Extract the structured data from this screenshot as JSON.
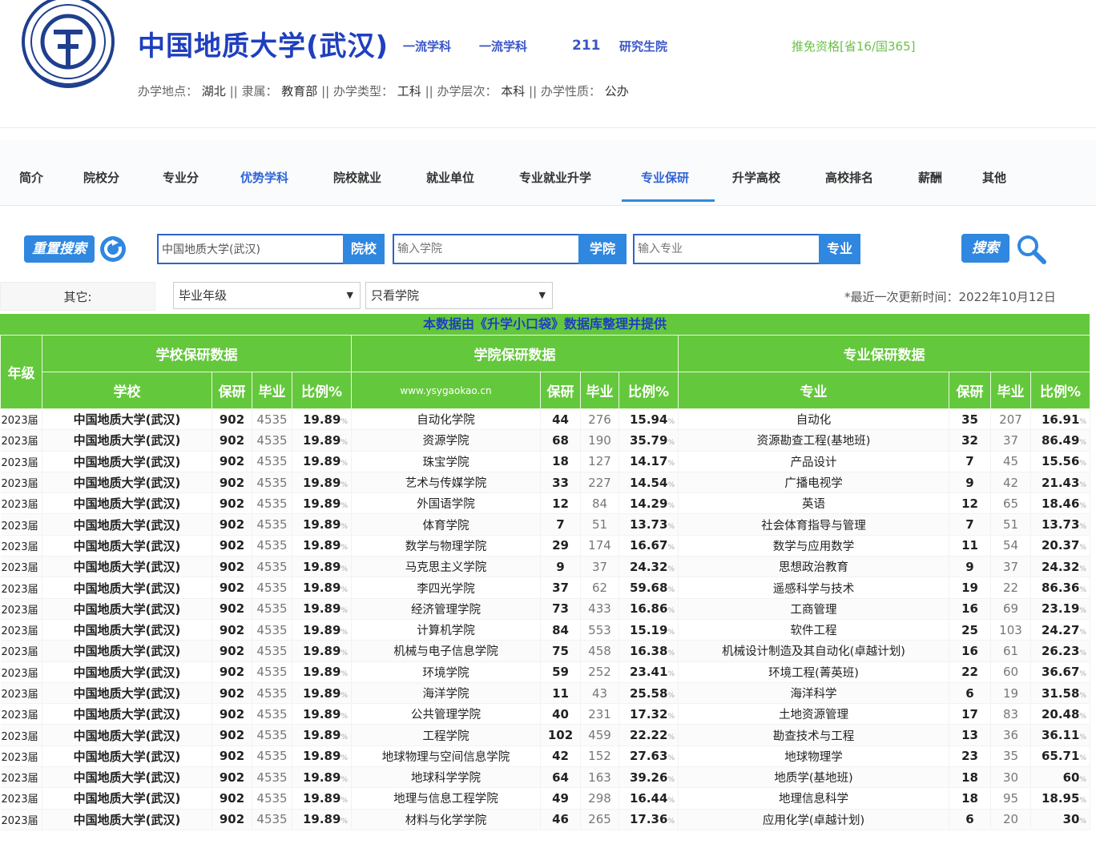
{
  "school": {
    "name": "中国地质大学(武汉)",
    "tags": [
      "一流学科",
      "一流学科",
      "211",
      "研究生院"
    ],
    "exemption": "推免资格[省16/国365]",
    "info": {
      "location_label": "办学地点：",
      "location": "湖北",
      "affiliation_label": "隶属：",
      "affiliation": "教育部",
      "type_label": "办学类型：",
      "type": "工科",
      "level_label": "办学层次：",
      "level": "本科",
      "nature_label": "办学性质：",
      "nature": "公办",
      "separator": "||"
    }
  },
  "nav": {
    "items": [
      "简介",
      "院校分",
      "专业分",
      "优势学科",
      "院校就业",
      "就业单位",
      "专业就业升学",
      "专业保研",
      "升学高校",
      "高校排名",
      "薪酬",
      "其他"
    ],
    "active_index": 7,
    "highlight_index": 3
  },
  "search": {
    "reset_label": "重置搜索",
    "school_value": "中国地质大学(武汉)",
    "school_btn": "院校",
    "college_placeholder": "输入学院",
    "college_btn": "学院",
    "major_placeholder": "输入专业",
    "major_btn": "专业",
    "search_label": "搜索"
  },
  "filters": {
    "other_label": "其它:",
    "grade_select": "毕业年级",
    "college_select": "只看学院",
    "update_time": "*最近一次更新时间：2022年10月12日"
  },
  "table": {
    "banner": "本数据由《升学小口袋》数据库整理并提供",
    "year_header": "年级",
    "group_headers": [
      "学校保研数据",
      "学院保研数据",
      "专业保研数据"
    ],
    "col_school": "学校",
    "col_recommend": "保研",
    "col_graduate": "毕业",
    "col_ratio": "比例%",
    "col_college": "www.ysygaokao.cn",
    "col_major": "专业",
    "percent_sign": "%",
    "rows": [
      {
        "year": "2023届",
        "school": "中国地质大学(武汉)",
        "s_rec": "902",
        "s_grad": "4535",
        "s_ratio": "19.89",
        "college": "自动化学院",
        "c_rec": "44",
        "c_grad": "276",
        "c_ratio": "15.94",
        "major": "自动化",
        "m_rec": "35",
        "m_grad": "207",
        "m_ratio": "16.91"
      },
      {
        "year": "2023届",
        "school": "中国地质大学(武汉)",
        "s_rec": "902",
        "s_grad": "4535",
        "s_ratio": "19.89",
        "college": "资源学院",
        "c_rec": "68",
        "c_grad": "190",
        "c_ratio": "35.79",
        "major": "资源勘查工程(基地班)",
        "m_rec": "32",
        "m_grad": "37",
        "m_ratio": "86.49"
      },
      {
        "year": "2023届",
        "school": "中国地质大学(武汉)",
        "s_rec": "902",
        "s_grad": "4535",
        "s_ratio": "19.89",
        "college": "珠宝学院",
        "c_rec": "18",
        "c_grad": "127",
        "c_ratio": "14.17",
        "major": "产品设计",
        "m_rec": "7",
        "m_grad": "45",
        "m_ratio": "15.56"
      },
      {
        "year": "2023届",
        "school": "中国地质大学(武汉)",
        "s_rec": "902",
        "s_grad": "4535",
        "s_ratio": "19.89",
        "college": "艺术与传媒学院",
        "c_rec": "33",
        "c_grad": "227",
        "c_ratio": "14.54",
        "major": "广播电视学",
        "m_rec": "9",
        "m_grad": "42",
        "m_ratio": "21.43"
      },
      {
        "year": "2023届",
        "school": "中国地质大学(武汉)",
        "s_rec": "902",
        "s_grad": "4535",
        "s_ratio": "19.89",
        "college": "外国语学院",
        "c_rec": "12",
        "c_grad": "84",
        "c_ratio": "14.29",
        "major": "英语",
        "m_rec": "12",
        "m_grad": "65",
        "m_ratio": "18.46"
      },
      {
        "year": "2023届",
        "school": "中国地质大学(武汉)",
        "s_rec": "902",
        "s_grad": "4535",
        "s_ratio": "19.89",
        "college": "体育学院",
        "c_rec": "7",
        "c_grad": "51",
        "c_ratio": "13.73",
        "major": "社会体育指导与管理",
        "m_rec": "7",
        "m_grad": "51",
        "m_ratio": "13.73"
      },
      {
        "year": "2023届",
        "school": "中国地质大学(武汉)",
        "s_rec": "902",
        "s_grad": "4535",
        "s_ratio": "19.89",
        "college": "数学与物理学院",
        "c_rec": "29",
        "c_grad": "174",
        "c_ratio": "16.67",
        "major": "数学与应用数学",
        "m_rec": "11",
        "m_grad": "54",
        "m_ratio": "20.37"
      },
      {
        "year": "2023届",
        "school": "中国地质大学(武汉)",
        "s_rec": "902",
        "s_grad": "4535",
        "s_ratio": "19.89",
        "college": "马克思主义学院",
        "c_rec": "9",
        "c_grad": "37",
        "c_ratio": "24.32",
        "major": "思想政治教育",
        "m_rec": "9",
        "m_grad": "37",
        "m_ratio": "24.32"
      },
      {
        "year": "2023届",
        "school": "中国地质大学(武汉)",
        "s_rec": "902",
        "s_grad": "4535",
        "s_ratio": "19.89",
        "college": "李四光学院",
        "c_rec": "37",
        "c_grad": "62",
        "c_ratio": "59.68",
        "major": "遥感科学与技术",
        "m_rec": "19",
        "m_grad": "22",
        "m_ratio": "86.36"
      },
      {
        "year": "2023届",
        "school": "中国地质大学(武汉)",
        "s_rec": "902",
        "s_grad": "4535",
        "s_ratio": "19.89",
        "college": "经济管理学院",
        "c_rec": "73",
        "c_grad": "433",
        "c_ratio": "16.86",
        "major": "工商管理",
        "m_rec": "16",
        "m_grad": "69",
        "m_ratio": "23.19"
      },
      {
        "year": "2023届",
        "school": "中国地质大学(武汉)",
        "s_rec": "902",
        "s_grad": "4535",
        "s_ratio": "19.89",
        "college": "计算机学院",
        "c_rec": "84",
        "c_grad": "553",
        "c_ratio": "15.19",
        "major": "软件工程",
        "m_rec": "25",
        "m_grad": "103",
        "m_ratio": "24.27"
      },
      {
        "year": "2023届",
        "school": "中国地质大学(武汉)",
        "s_rec": "902",
        "s_grad": "4535",
        "s_ratio": "19.89",
        "college": "机械与电子信息学院",
        "c_rec": "75",
        "c_grad": "458",
        "c_ratio": "16.38",
        "major": "机械设计制造及其自动化(卓越计划)",
        "m_rec": "16",
        "m_grad": "61",
        "m_ratio": "26.23"
      },
      {
        "year": "2023届",
        "school": "中国地质大学(武汉)",
        "s_rec": "902",
        "s_grad": "4535",
        "s_ratio": "19.89",
        "college": "环境学院",
        "c_rec": "59",
        "c_grad": "252",
        "c_ratio": "23.41",
        "major": "环境工程(菁英班)",
        "m_rec": "22",
        "m_grad": "60",
        "m_ratio": "36.67"
      },
      {
        "year": "2023届",
        "school": "中国地质大学(武汉)",
        "s_rec": "902",
        "s_grad": "4535",
        "s_ratio": "19.89",
        "college": "海洋学院",
        "c_rec": "11",
        "c_grad": "43",
        "c_ratio": "25.58",
        "major": "海洋科学",
        "m_rec": "6",
        "m_grad": "19",
        "m_ratio": "31.58"
      },
      {
        "year": "2023届",
        "school": "中国地质大学(武汉)",
        "s_rec": "902",
        "s_grad": "4535",
        "s_ratio": "19.89",
        "college": "公共管理学院",
        "c_rec": "40",
        "c_grad": "231",
        "c_ratio": "17.32",
        "major": "土地资源管理",
        "m_rec": "17",
        "m_grad": "83",
        "m_ratio": "20.48"
      },
      {
        "year": "2023届",
        "school": "中国地质大学(武汉)",
        "s_rec": "902",
        "s_grad": "4535",
        "s_ratio": "19.89",
        "college": "工程学院",
        "c_rec": "102",
        "c_grad": "459",
        "c_ratio": "22.22",
        "major": "勘查技术与工程",
        "m_rec": "13",
        "m_grad": "36",
        "m_ratio": "36.11"
      },
      {
        "year": "2023届",
        "school": "中国地质大学(武汉)",
        "s_rec": "902",
        "s_grad": "4535",
        "s_ratio": "19.89",
        "college": "地球物理与空间信息学院",
        "c_rec": "42",
        "c_grad": "152",
        "c_ratio": "27.63",
        "major": "地球物理学",
        "m_rec": "23",
        "m_grad": "35",
        "m_ratio": "65.71"
      },
      {
        "year": "2023届",
        "school": "中国地质大学(武汉)",
        "s_rec": "902",
        "s_grad": "4535",
        "s_ratio": "19.89",
        "college": "地球科学学院",
        "c_rec": "64",
        "c_grad": "163",
        "c_ratio": "39.26",
        "major": "地质学(基地班)",
        "m_rec": "18",
        "m_grad": "30",
        "m_ratio": "60"
      },
      {
        "year": "2023届",
        "school": "中国地质大学(武汉)",
        "s_rec": "902",
        "s_grad": "4535",
        "s_ratio": "19.89",
        "college": "地理与信息工程学院",
        "c_rec": "49",
        "c_grad": "298",
        "c_ratio": "16.44",
        "major": "地理信息科学",
        "m_rec": "18",
        "m_grad": "95",
        "m_ratio": "18.95"
      },
      {
        "year": "2023届",
        "school": "中国地质大学(武汉)",
        "s_rec": "902",
        "s_grad": "4535",
        "s_ratio": "19.89",
        "college": "材料与化学学院",
        "c_rec": "46",
        "c_grad": "265",
        "c_ratio": "17.36",
        "major": "应用化学(卓越计划)",
        "m_rec": "6",
        "m_grad": "20",
        "m_ratio": "30"
      }
    ]
  },
  "colors": {
    "brand_blue": "#1f3fbe",
    "button_blue": "#2f87e0",
    "table_green": "#64c83c",
    "exemption_green": "#6cc04a"
  }
}
